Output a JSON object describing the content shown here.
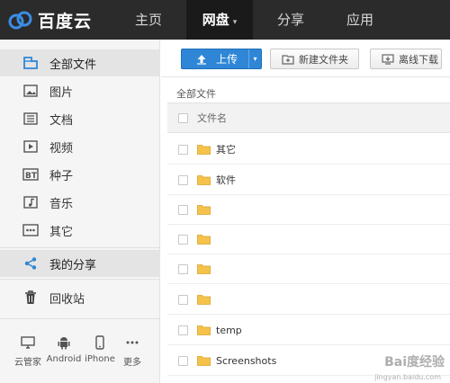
{
  "app": {
    "logo_text": "百度云"
  },
  "nav": [
    {
      "label": "主页",
      "active": false
    },
    {
      "label": "网盘",
      "active": true
    },
    {
      "label": "分享",
      "active": false
    },
    {
      "label": "应用",
      "active": false
    }
  ],
  "sidebar": {
    "items": [
      {
        "label": "全部文件",
        "icon": "all-files-icon"
      },
      {
        "label": "图片",
        "icon": "image-icon"
      },
      {
        "label": "文档",
        "icon": "document-icon"
      },
      {
        "label": "视频",
        "icon": "video-icon"
      },
      {
        "label": "种子",
        "icon": "torrent-icon"
      },
      {
        "label": "音乐",
        "icon": "music-icon"
      },
      {
        "label": "其它",
        "icon": "other-icon"
      },
      {
        "label": "我的分享",
        "icon": "share-icon"
      },
      {
        "label": "回收站",
        "icon": "trash-icon"
      }
    ],
    "devices": [
      {
        "label": "云管家",
        "icon": "pc-icon"
      },
      {
        "label": "Android",
        "icon": "android-icon"
      },
      {
        "label": "iPhone",
        "icon": "iphone-icon"
      },
      {
        "label": "更多",
        "icon": "more-icon"
      }
    ]
  },
  "toolbar": {
    "upload_label": "上传",
    "new_folder_label": "新建文件夹",
    "offline_download_label": "离线下载"
  },
  "breadcrumb": "全部文件",
  "file_list": {
    "column_name": "文件名",
    "rows": [
      "其它",
      "软件",
      "",
      "",
      "",
      "",
      "temp",
      "Screenshots"
    ]
  },
  "colors": {
    "accent": "#2f86d6",
    "topbar": "#2b2b2b",
    "folder": "#f5c24c"
  },
  "watermark": {
    "text": "Bai度经验",
    "sub": "jingyan.baidu.com"
  }
}
